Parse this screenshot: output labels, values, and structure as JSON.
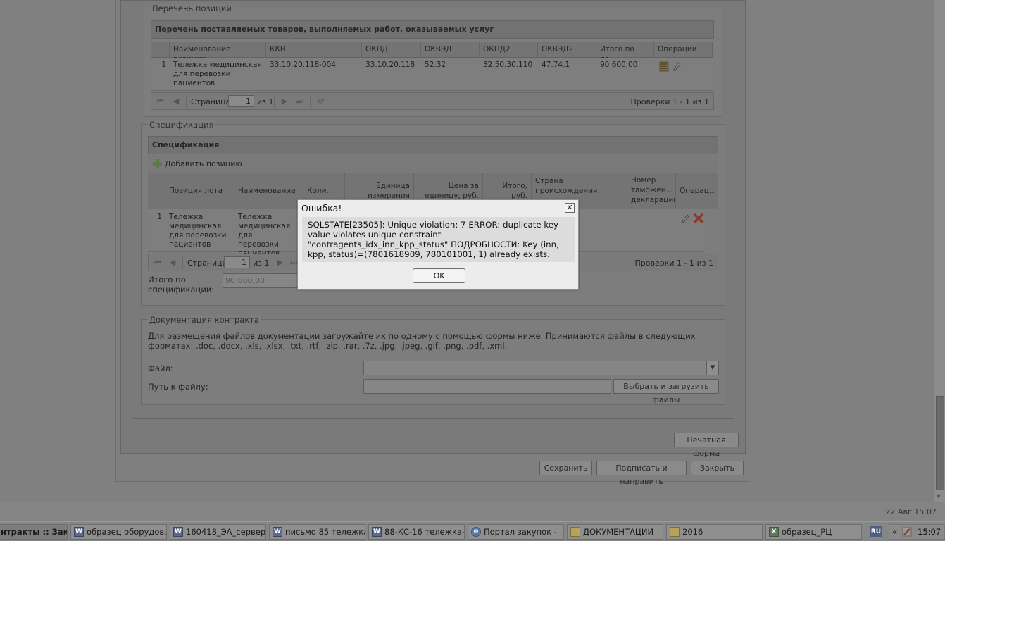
{
  "positions_section": {
    "legend": "Перечень позиций",
    "grid_title": "Перечень поставляемых товаров, выполняемых работ, оказываемых услуг",
    "columns": [
      "Наименование позиции",
      "ККН",
      "ОКПД",
      "ОКВЭД",
      "ОКПД2",
      "ОКВЭД2",
      "Итого по по...",
      "Операции"
    ],
    "rows": [
      {
        "num": "1",
        "name": "Тележка медицинская для перевозки пациентов",
        "kkn": "33.10.20.118-004",
        "okpd": "33.10.20.118",
        "okved": "52.32",
        "okpd2": "32.50.30.110",
        "okved2": "47.74.1",
        "total": "90 600,00"
      }
    ],
    "pager": {
      "page_label": "Страница",
      "page": "1",
      "of_label": "из 1",
      "summary": "Проверки 1 - 1 из 1"
    }
  },
  "spec_section": {
    "legend": "Спецификация",
    "grid_title": "Спецификация",
    "add_button": "Добавить позицию",
    "columns": [
      "Позиция лота",
      "Наименование",
      "Коли...",
      "Единица измерения",
      "Цена за единицу, руб.",
      "Итого, руб.",
      "Страна происхождения",
      "Номер таможен... декларации",
      "Операц..."
    ],
    "rows": [
      {
        "num": "1",
        "lot_position": "Тележка медицинская для перевозки пациентов",
        "name": "Тележка медицинская для перевозки пациентов"
      }
    ],
    "pager": {
      "page_label": "Страница",
      "page": "1",
      "of_label": "из 1",
      "summary": "Проверки 1 - 1 из 1"
    },
    "total_label": "Итого по спецификации:",
    "total_value": "90 600,00"
  },
  "docs_section": {
    "legend": "Документация контракта",
    "description": "Для размещения файлов документации загружайте их по одному с помощью формы ниже. Принимаются файлы в следующих форматах: .doc, .docx, .xls, .xlsx, .txt, .rtf, .zip, .rar, .7z, .jpg, .jpeg, .gif, .png, .pdf, .xml.",
    "file_label": "Файл:",
    "path_label": "Путь к файлу:",
    "upload_button": "Выбрать и загрузить файлы"
  },
  "actions": {
    "print": "Печатная форма",
    "save": "Сохранить",
    "sign_send": "Подписать и направить",
    "close": "Закрыть"
  },
  "dialog": {
    "title": "Ошибка!",
    "message": "SQLSTATE[23505]: Unique violation: 7 ERROR: duplicate key value violates unique constraint \"contragents_idx_inn_kpp_status\" ПОДРОБНОСТИ: Key (inn, kpp, status)=(7801618909, 780101001, 1) already exists.",
    "ok": "OK",
    "close_glyph": "✕"
  },
  "status_strip": {
    "datetime": "22 Авг 15:07"
  },
  "taskbar": {
    "tasks": [
      {
        "label": "нтракты :: Зак...",
        "icon": "browser"
      },
      {
        "label": "образец оборудов...",
        "icon": "word"
      },
      {
        "label": "160418_ЭА_сервер...",
        "icon": "word"
      },
      {
        "label": "письмо 85 тележка...",
        "icon": "word"
      },
      {
        "label": "88-КС-16 тележка-...",
        "icon": "word"
      },
      {
        "label": "Портал закупок - ...",
        "icon": "ie"
      },
      {
        "label": "ДОКУМЕНТАЦИИ",
        "icon": "folder"
      },
      {
        "label": "2016",
        "icon": "folder"
      },
      {
        "label": "образец_РЦ",
        "icon": "excel"
      }
    ],
    "language": "RU",
    "tray_arrows": "«",
    "clock": "15:07"
  }
}
